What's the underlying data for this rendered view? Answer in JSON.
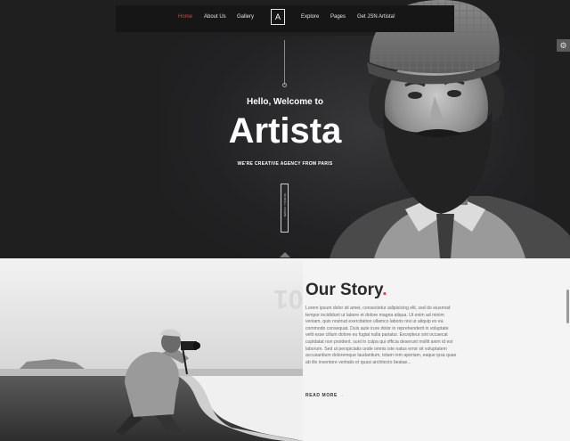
{
  "nav": {
    "items_left": [
      {
        "label": "Home",
        "active": true
      },
      {
        "label": "About Us",
        "active": false
      },
      {
        "label": "Gallery",
        "active": false
      }
    ],
    "logo_letter": "A",
    "items_right": [
      {
        "label": "Explore",
        "active": false
      },
      {
        "label": "Pages",
        "active": false
      },
      {
        "label": "Get JSN Artista!",
        "active": false
      }
    ]
  },
  "hero": {
    "greeting": "Hello, Welcome to",
    "brand": "Artista",
    "tagline": "WE'RE CREATIVE AGENCY FROM PARIS",
    "scroll_label": "SCROLL DOWN"
  },
  "story": {
    "section_number": "01",
    "title": "Our Story",
    "title_dot": ".",
    "body": "Lorem ipsum dolor sit amet, consectetur adipisicing elit, sed do eiusmod tempor incididunt ut labore et dolore magna aliqua. Ut enim ad minim veniam, quis nostrud exercitation ullamco laboris nisi ut aliquip ex ea commodo consequat. Duis aute irure dolor in reprehenderit in voluptate velit esse cillum dolore eu fugiat nulla pariatur. Excepteur sint occaecat cupidatat non proident, sunt in culpa qui officia deserunt mollit anim id est laborum. Sed ut perspiciatis unde omnis iste natus error sit voluptatem accusantium doloremque laudantium, totam rem aperiam, eaque ipsa quae ab illo inventore veritatis et quasi architecto beatae...",
    "read_more": "READ MORE",
    "read_more_arrow": "→"
  },
  "icons": {
    "settings": "gear-icon",
    "scroll": "arrow-down-icon"
  },
  "colors": {
    "accent": "#e0404a",
    "hero_bg": "#1f1f20",
    "story_bg": "#f4f4f4"
  }
}
